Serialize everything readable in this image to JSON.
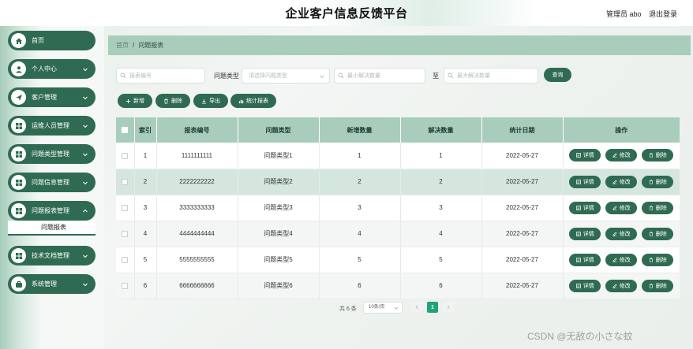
{
  "header": {
    "title": "企业客户信息反馈平台",
    "user": "管理员 abo",
    "logout": "退出登录"
  },
  "sidebar": {
    "items": [
      {
        "label": "首页",
        "icon": "home-icon"
      },
      {
        "label": "个人中心",
        "icon": "user-icon"
      },
      {
        "label": "客户管理",
        "icon": "send-icon"
      },
      {
        "label": "运维人员管理",
        "icon": "grid-icon"
      },
      {
        "label": "问题类型管理",
        "icon": "grid-icon"
      },
      {
        "label": "问题信息管理",
        "icon": "grid-icon"
      },
      {
        "label": "问题报表管理",
        "icon": "grid-icon"
      },
      {
        "label": "技术文档管理",
        "icon": "grid-icon"
      },
      {
        "label": "系统管理",
        "icon": "briefcase-icon"
      }
    ],
    "sub_item": "问题报表"
  },
  "breadcrumb": {
    "home": "首页",
    "sep": "/",
    "current": "问题报表"
  },
  "search": {
    "code_placeholder": "报表编号",
    "type_label": "问题类型",
    "type_placeholder": "请选择问题类型",
    "min_placeholder": "最小解决数量",
    "to_label": "至",
    "max_placeholder": "最大解决数量",
    "query_label": "查询"
  },
  "toolbar": {
    "add": "新增",
    "delete": "删除",
    "export": "导出",
    "stats": "统计报表"
  },
  "table": {
    "columns": [
      "索引",
      "报表编号",
      "问题类型",
      "新增数量",
      "解决数量",
      "统计日期",
      "操作"
    ],
    "rows": [
      {
        "index": "1",
        "code": "1111111111",
        "type": "问题类型1",
        "added": "1",
        "solved": "1",
        "date": "2022-05-27"
      },
      {
        "index": "2",
        "code": "2222222222",
        "type": "问题类型2",
        "added": "2",
        "solved": "2",
        "date": "2022-05-27"
      },
      {
        "index": "3",
        "code": "3333333333",
        "type": "问题类型3",
        "added": "3",
        "solved": "3",
        "date": "2022-05-27"
      },
      {
        "index": "4",
        "code": "4444444444",
        "type": "问题类型4",
        "added": "4",
        "solved": "4",
        "date": "2022-05-27"
      },
      {
        "index": "5",
        "code": "5555555555",
        "type": "问题类型5",
        "added": "5",
        "solved": "5",
        "date": "2022-05-27"
      },
      {
        "index": "6",
        "code": "6666666666",
        "type": "问题类型6",
        "added": "6",
        "solved": "6",
        "date": "2022-05-27"
      }
    ],
    "ops": {
      "detail": "详情",
      "edit": "修改",
      "delete": "删除"
    }
  },
  "pagination": {
    "total": "共 6 条",
    "page_size": "10条/页",
    "current": "1"
  },
  "watermark": "CSDN @无敌の小さな蚊",
  "colors": {
    "primary": "#2f6b52",
    "header_bg": "#a9cdbb",
    "page_active": "#1fa37a"
  }
}
